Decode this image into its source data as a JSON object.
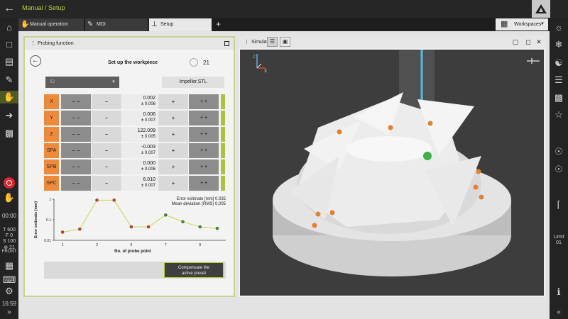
{
  "header": {
    "breadcrumb": "Manual / Setup"
  },
  "tabs": [
    {
      "label": "Manual operation",
      "active": false
    },
    {
      "label": "MDI",
      "active": false
    },
    {
      "label": "Setup",
      "active": true
    }
  ],
  "workspaces_label": "Workspaces",
  "left_rail": {
    "time_label": "00:00",
    "status": [
      {
        "key": "T",
        "value": "600"
      },
      {
        "key": "F",
        "value": "0"
      },
      {
        "key": "S",
        "value": "100"
      },
      {
        "key": "⊕",
        "value": "21"
      }
    ],
    "front_label": "FRONT",
    "clock": "16:59"
  },
  "right_rail": {
    "limit_label": "Limit",
    "limit_value": "01"
  },
  "probing": {
    "panel_title": "Probing function",
    "title": "Set up the workpiece",
    "point_count": "21",
    "select_placeholder": "ID",
    "file": "Impeller.STL",
    "minusminus": "− −",
    "minus": "−",
    "plus": "+",
    "plusplus": "+ +",
    "axes": [
      {
        "name": "X",
        "value": "0.002",
        "tolerance": "± 0.006"
      },
      {
        "name": "Y",
        "value": "0.006",
        "tolerance": "± 0.007"
      },
      {
        "name": "Z",
        "value": "122.009",
        "tolerance": "± 0.005"
      },
      {
        "name": "SPA",
        "value": "-0.003",
        "tolerance": "± 0.007"
      },
      {
        "name": "SPB",
        "value": "0.000",
        "tolerance": "± 0.006"
      },
      {
        "name": "SPC",
        "value": "6.010",
        "tolerance": "± 0.007"
      }
    ],
    "compensate_line1": "Compensate the",
    "compensate_line2": "active preset"
  },
  "simulation": {
    "title": "Simulation"
  },
  "chart_data": {
    "type": "line",
    "xlabel": "No. of probe point",
    "ylabel": "Error estimate (mm)",
    "yscale": "log",
    "ylim": [
      0.01,
      1
    ],
    "y_ticks": [
      "1",
      "0.1",
      "0.01"
    ],
    "x_ticks": [
      "1",
      "3",
      "5",
      "7",
      "9"
    ],
    "annotation_1": "Error estimate [mm]  0.035",
    "annotation_2": "Mean deviation (RMS)  0.005",
    "x": [
      1,
      2,
      3,
      4,
      5,
      6,
      7,
      8,
      9,
      10
    ],
    "values": [
      0.025,
      0.035,
      0.9,
      0.9,
      0.045,
      0.045,
      0.17,
      0.08,
      0.045,
      0.038
    ],
    "point_colors": [
      "#d8402a",
      "#d8402a",
      "#d8402a",
      "#d8402a",
      "#d8402a",
      "#d8402a",
      "#3e9a3a",
      "#3e9a3a",
      "#3e9a3a",
      "#3e9a3a"
    ],
    "line_color": "#c8d64a",
    "grid": false
  },
  "colors": {
    "accent": "#b9cf3a",
    "axis_label": "#ef8a3a",
    "status_ok": "#a9c33a"
  }
}
